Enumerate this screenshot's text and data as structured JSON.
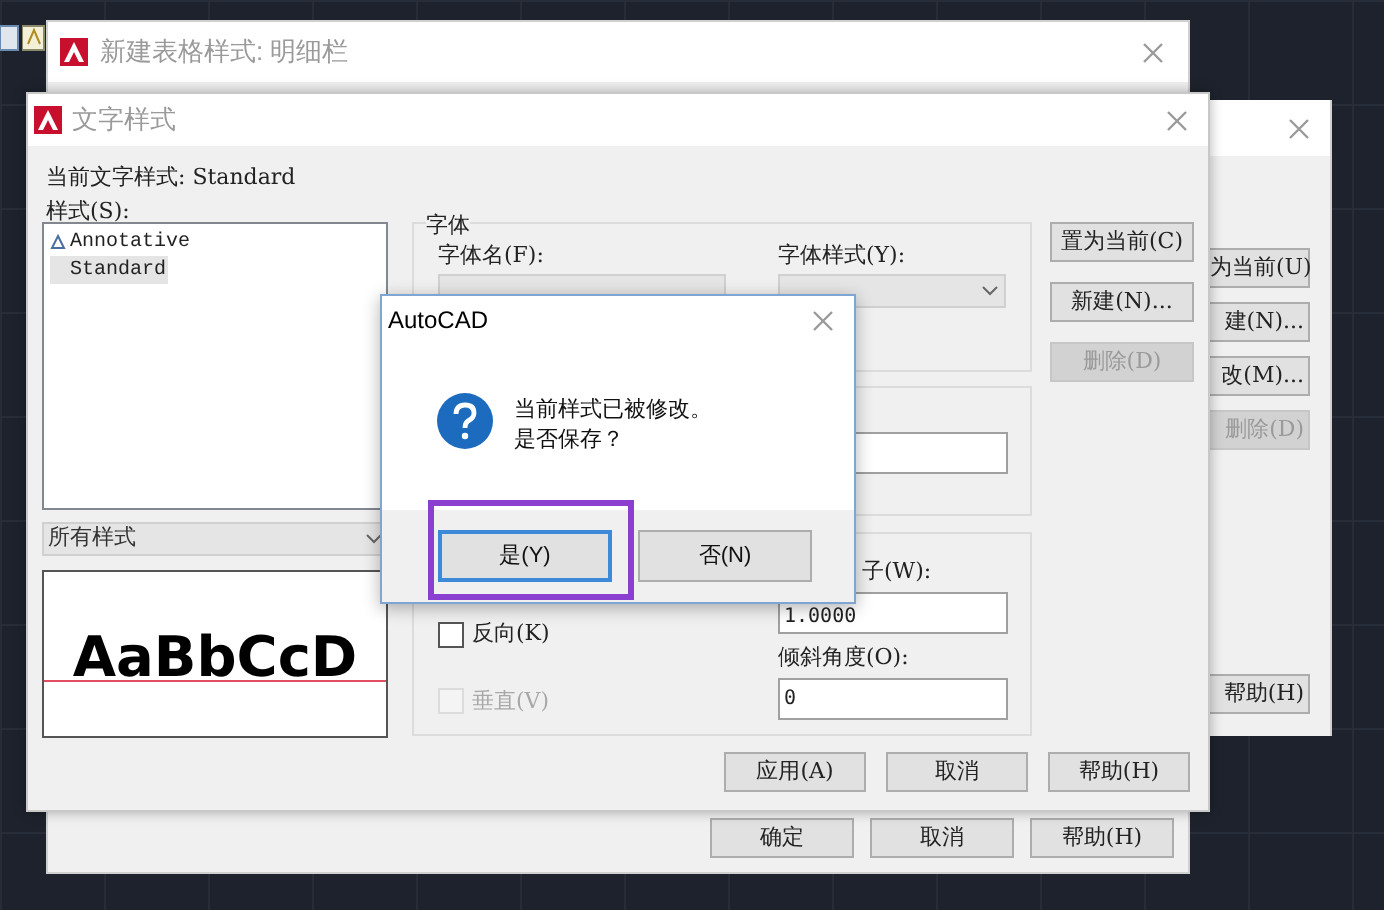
{
  "table_style_window": {
    "title": "新建表格样式: 明细栏",
    "buttons": [
      {
        "label": "确定",
        "disabled": false
      },
      {
        "label": "取消",
        "disabled": false
      },
      {
        "label": "帮助(H)",
        "disabled": false
      }
    ]
  },
  "back_window": {
    "buttons": [
      {
        "label": "为当前(U)",
        "disabled": false
      },
      {
        "label": "建(N)...",
        "disabled": false
      },
      {
        "label": "改(M)...",
        "disabled": false
      },
      {
        "label": "删除(D)",
        "disabled": true
      },
      {
        "label": "帮助(H)",
        "disabled": false
      }
    ]
  },
  "text_style_window": {
    "title": "文字样式",
    "current_style": "当前文字样式: Standard",
    "styles_label": "样式(S):",
    "styles": [
      {
        "name": "Annotative",
        "annotative": true,
        "selected": false
      },
      {
        "name": "Standard",
        "annotative": false,
        "selected": true
      }
    ],
    "filter": "所有样式",
    "preview_text": "AaBbCcD",
    "font_group": {
      "title": "字体",
      "font_name_label": "字体名(F):",
      "font_style_label": "字体样式(Y):"
    },
    "effects_group": {
      "checkboxes": [
        {
          "label": "反向(K)",
          "checked": false,
          "disabled": false
        },
        {
          "label": "垂直(V)",
          "checked": false,
          "disabled": true
        }
      ],
      "width_factor_label": "子(W):",
      "width_factor": "1.0000",
      "oblique_label": "倾斜角度(O):",
      "oblique": "0"
    },
    "side_buttons": [
      {
        "label": "置为当前(C)",
        "disabled": false
      },
      {
        "label": "新建(N)...",
        "disabled": false
      },
      {
        "label": "删除(D)",
        "disabled": true
      }
    ],
    "bottom_buttons": [
      {
        "label": "应用(A)",
        "disabled": false
      },
      {
        "label": "取消",
        "disabled": false
      },
      {
        "label": "帮助(H)",
        "disabled": false
      }
    ]
  },
  "alert": {
    "title": "AutoCAD",
    "message": [
      "当前样式已被修改。",
      "是否保存？"
    ],
    "buttons": [
      {
        "label": "是(Y)",
        "focused": true,
        "highlighted": true
      },
      {
        "label": "否(N)",
        "focused": false,
        "highlighted": false
      }
    ]
  }
}
